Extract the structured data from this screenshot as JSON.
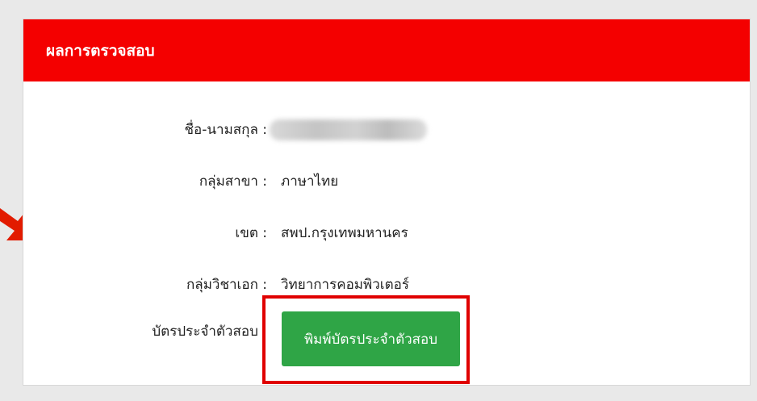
{
  "panel": {
    "title": "ผลการตรวจสอบ"
  },
  "fields": [
    {
      "label": "ชื่อ-นามสกุล  :",
      "value": ""
    },
    {
      "label": "กลุ่มสาขา  :",
      "value": "ภาษาไทย"
    },
    {
      "label": "เขต  :",
      "value": "สพป.กรุงเทพมหานคร"
    },
    {
      "label": "กลุ่มวิชาเอก  :",
      "value": "วิทยาการคอมพิวเตอร์"
    },
    {
      "label": "บัตรประจำตัวสอบ  :",
      "value": ""
    }
  ],
  "print_button": {
    "label": "พิมพ์บัตรประจำตัวสอบ"
  },
  "colors": {
    "header": "#f40000",
    "button": "#2fa546",
    "highlight": "#e00000",
    "arrow": "#e21b00"
  }
}
